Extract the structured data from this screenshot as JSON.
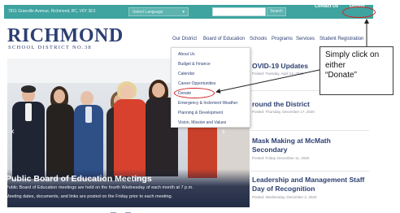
{
  "topbar": {
    "address": "7811 Granville Avenue, Richmond, BC, V6Y 3E3",
    "language_select": "Select Language",
    "search_button": "Search",
    "contact_link": "Contact Us",
    "donate_link": "Donate"
  },
  "logo": {
    "title": "RICHMOND",
    "subtitle": "SCHOOL DISTRICT NO.38"
  },
  "nav": {
    "items": [
      "Our District",
      "Board of Education",
      "Schools",
      "Programs",
      "Services",
      "Student Registration"
    ]
  },
  "dropdown": {
    "items": [
      "About Us",
      "Budget & Finance",
      "Calendar",
      "Career Opportunities",
      "Donate",
      "Emergency & Inclement Weather",
      "Planning & Development",
      "Vision, Mission and Values"
    ]
  },
  "hero": {
    "title": "Public Board of Education Meetings",
    "description_line1": "Public Board of Education meetings are held on the fourth Wednesday of each month at 7 p.m.",
    "description_line2": "Meeting dates, documents, and links are posted on the Friday prior to each meeting."
  },
  "news": [
    {
      "title": "OVID-19 Updates",
      "date": "Posted: Tuesday, April 14, 2020"
    },
    {
      "title": "round the District",
      "date": "Posted: Thursday, December 17, 2020"
    },
    {
      "title_line1": "Mask Making at McMath",
      "title_line2": "Secondary",
      "date": "Posted: Friday, December 11, 2020"
    },
    {
      "title_line1": "Leadership and Management Staff",
      "title_line2": "Day of Recognition",
      "date": "Posted: Wednesday, December 2, 2020"
    }
  ],
  "callout": {
    "line1": "Simply click on",
    "line2": "either",
    "line3": "“Donate”"
  },
  "icons": {
    "language_chevron": "chevron-down-icon",
    "carousel_prev": "chevron-left-icon",
    "carousel_next": "chevron-right-icon"
  },
  "colors": {
    "topbar": "#3fa3a0",
    "brand_navy": "#2c3f72",
    "highlight_red": "#d32020"
  }
}
